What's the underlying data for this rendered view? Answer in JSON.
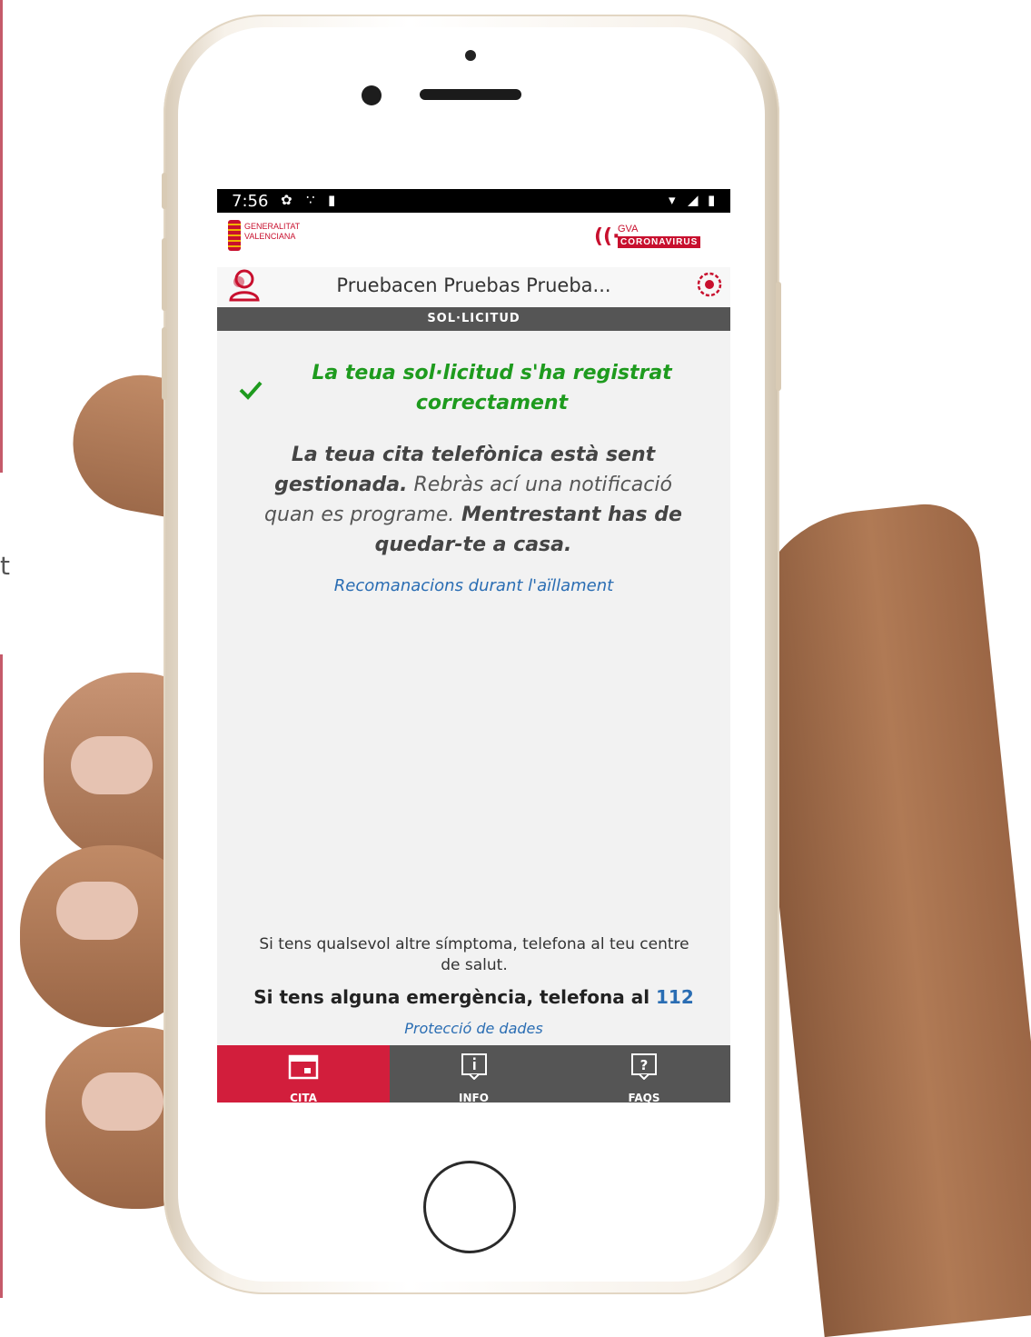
{
  "page": {
    "edge_char": "t"
  },
  "status": {
    "time": "7:56"
  },
  "brand": {
    "left_logo": [
      "GENERALITAT",
      "VALENCIANA"
    ],
    "right_logo_top": "GVA",
    "right_logo_bottom": "CORONAVIRUS"
  },
  "user": {
    "name": "Pruebacen Pruebas Prueba..."
  },
  "section": {
    "title": "SOL·LICITUD"
  },
  "success": {
    "message": "La teua sol·licitud s'ha registrat correctament"
  },
  "message": {
    "part1": "La teua cita telefònica està sent gestionada.",
    "part2": " Rebràs ací una notificació quan es programe.",
    "part3": " Mentrestant has de quedar-te a casa."
  },
  "links": {
    "recommendations": "Recomanacions durant l'aïllament",
    "privacy": "Protecció de dades"
  },
  "footer": {
    "symptom": "Si tens qualsevol altre símptoma, telefona al teu centre de salut.",
    "emergency_prefix": "Si tens alguna emergència, telefona al ",
    "emergency_number": "112"
  },
  "tabs": [
    {
      "label": "CITA",
      "icon": "calendar-icon",
      "active": true
    },
    {
      "label": "INFO",
      "icon": "info-icon",
      "active": false
    },
    {
      "label": "FAQS",
      "icon": "question-icon",
      "active": false
    }
  ],
  "colors": {
    "brand_red": "#c8102e",
    "active_tab": "#d21e3c",
    "success_green": "#1e9b1e",
    "link_blue": "#2a6db3",
    "dark_bar": "#555555"
  }
}
